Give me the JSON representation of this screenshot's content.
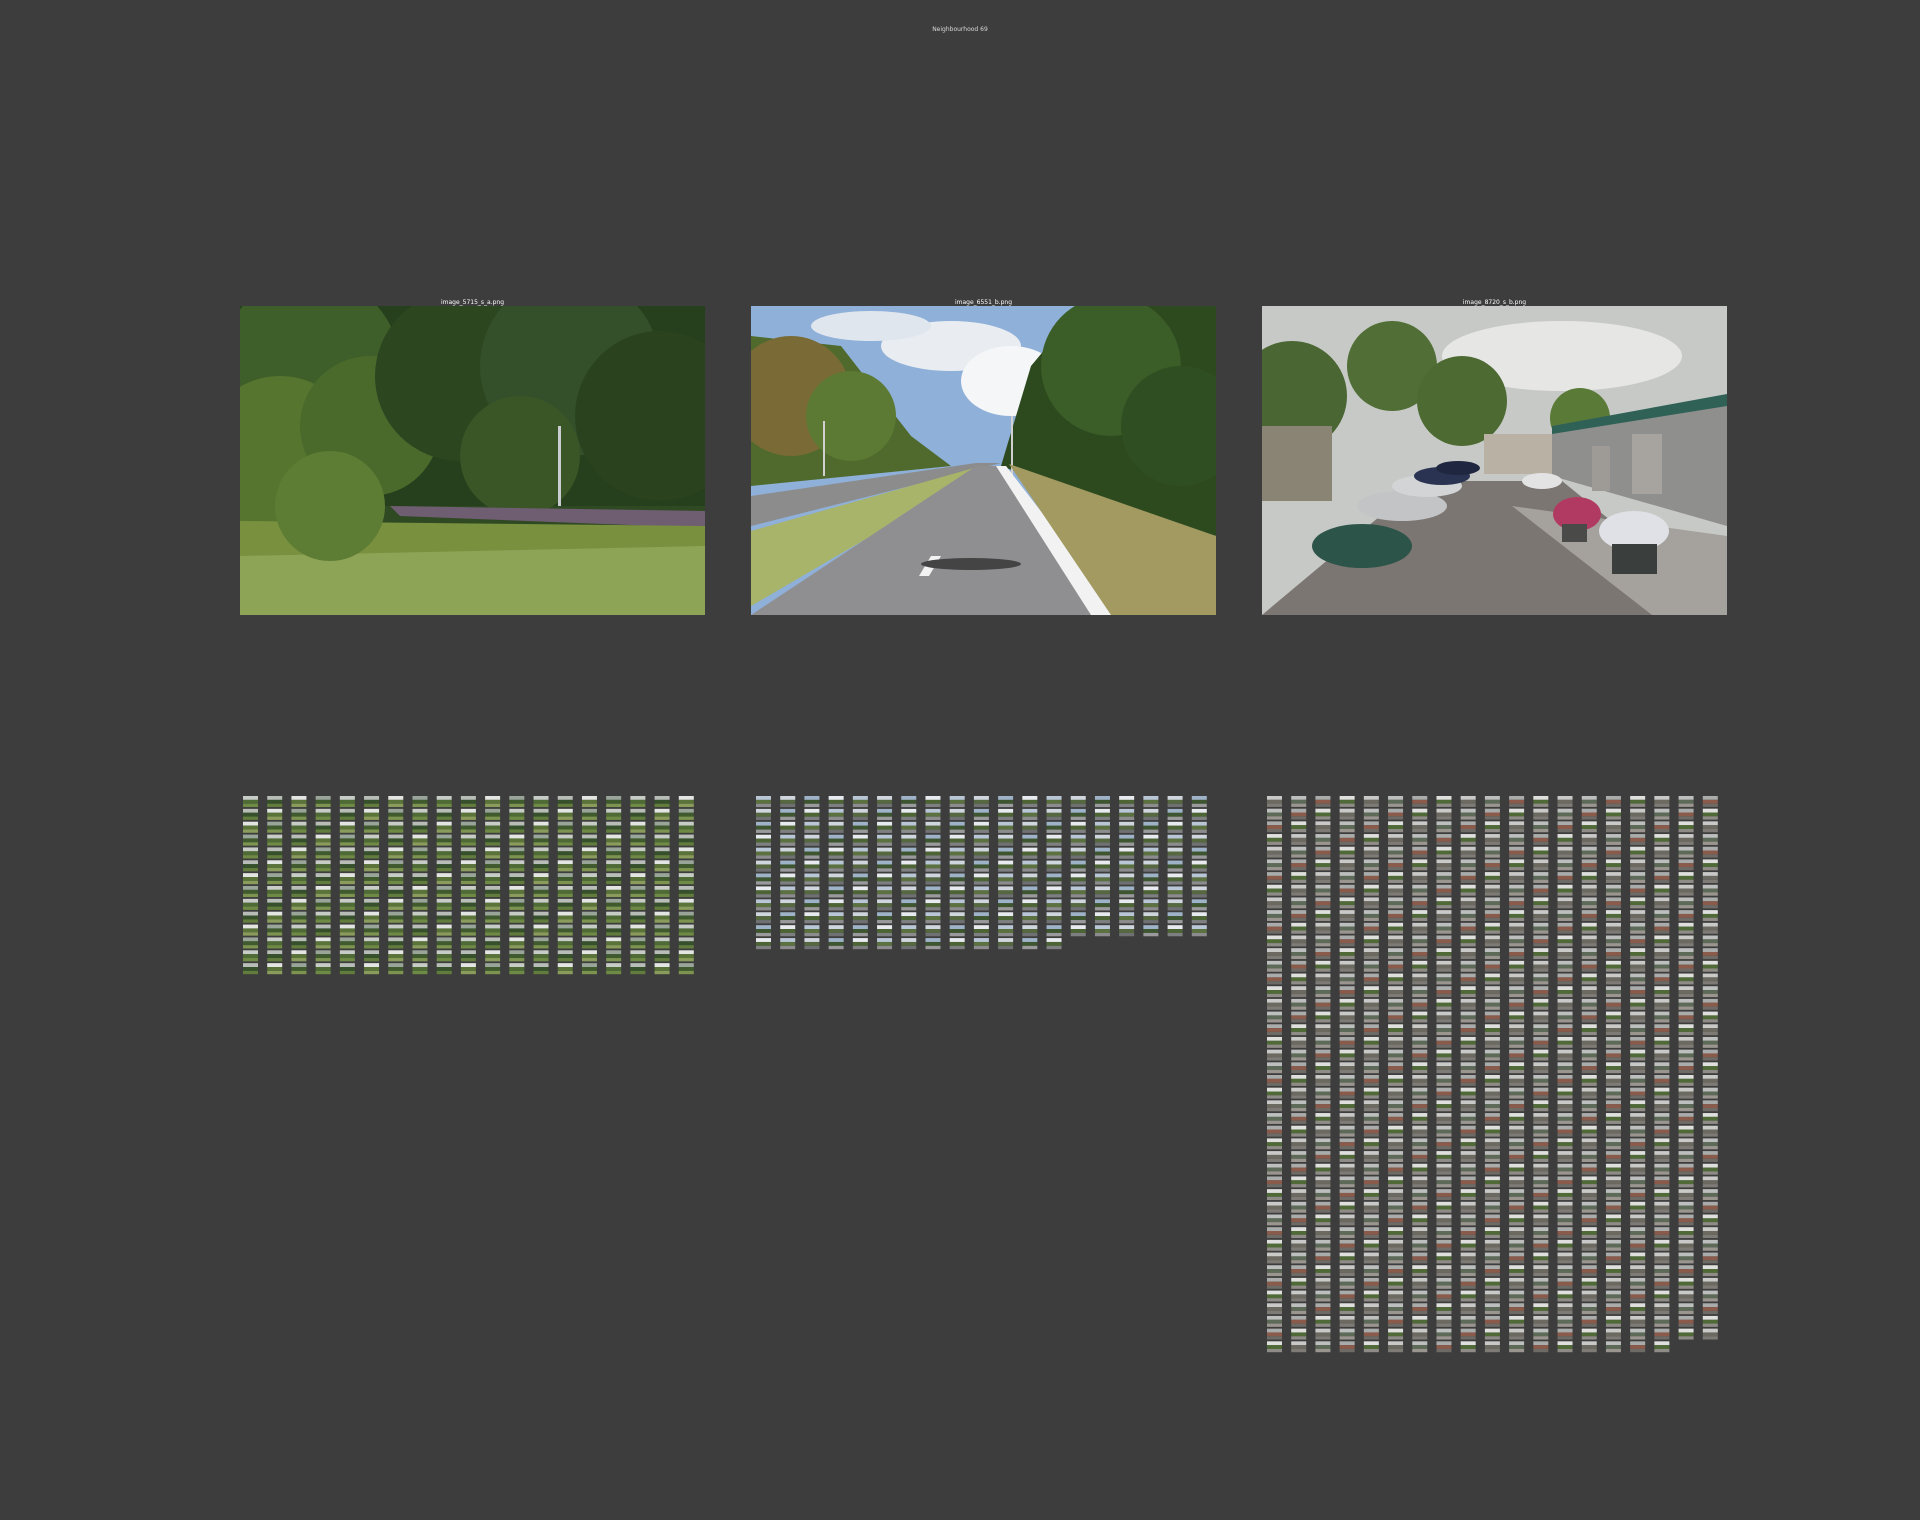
{
  "page": {
    "title": "Neighbourhood 69"
  },
  "panels": [
    {
      "caption": "image_5715_s_a.png",
      "scene": "dense-trees-and-grass"
    },
    {
      "caption": "image_6551_b.png",
      "scene": "road-with-trees"
    },
    {
      "caption": "image_8720_s_b.png",
      "scene": "street-with-cars-and-buildings"
    }
  ],
  "thumbnail_grids": [
    {
      "columns": 19,
      "rows": 14,
      "last_row_count": 19,
      "tone": "green"
    },
    {
      "columns": 19,
      "rows": 12,
      "last_row_count": 13,
      "tone": "road"
    },
    {
      "columns": 19,
      "rows": 44,
      "last_row_count": 17,
      "tone": "urban"
    }
  ],
  "colors": {
    "background": "#3d3d3d",
    "title": "#d9d9d9",
    "caption": "#ffffff"
  }
}
